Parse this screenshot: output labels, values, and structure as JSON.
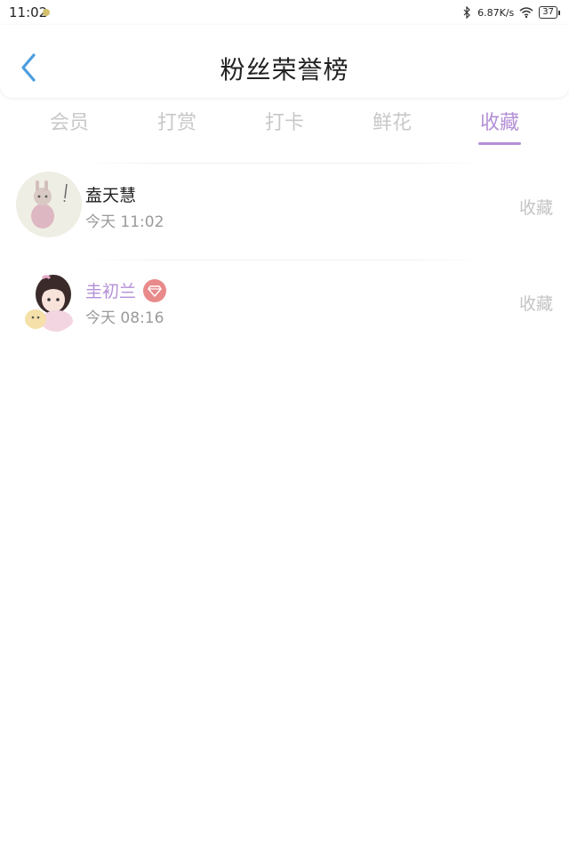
{
  "status_bar": {
    "time": "11:02",
    "network_speed": "6.87K/s",
    "battery": "37",
    "icons": [
      "notification-dot-icon",
      "bluetooth-icon",
      "wifi-icon",
      "battery-icon"
    ]
  },
  "header": {
    "title": "粉丝荣誉榜",
    "back_icon": "chevron-left-icon"
  },
  "tabs": [
    {
      "label": "会员",
      "active": false
    },
    {
      "label": "打赏",
      "active": false
    },
    {
      "label": "打卡",
      "active": false
    },
    {
      "label": "鲜花",
      "active": false
    },
    {
      "label": "收藏",
      "active": true
    }
  ],
  "fans": [
    {
      "name": "盍天慧",
      "time": "今天 11:02",
      "action": "收藏",
      "vip": false
    },
    {
      "name": "圭初兰",
      "time": "今天 08:16",
      "action": "收藏",
      "vip": true,
      "badge_icon": "diamond-icon"
    }
  ],
  "colors": {
    "accent": "#b48fd6",
    "back_arrow": "#4a9de0",
    "inactive_tab": "#c8c8c8",
    "vip_badge": "#e98a8a"
  }
}
